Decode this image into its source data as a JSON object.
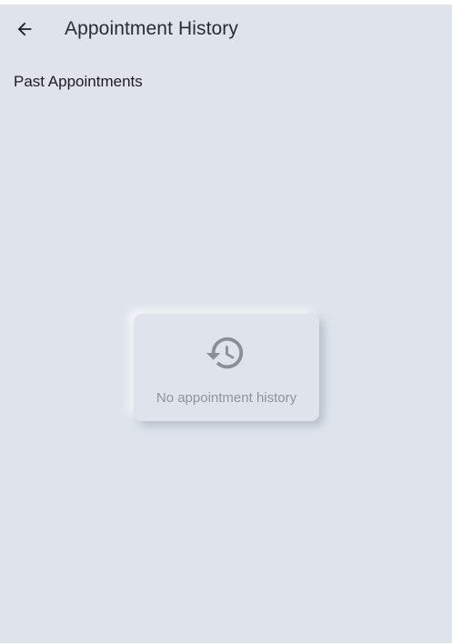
{
  "app_bar": {
    "title": "Appointment History",
    "back_icon": "arrow-back-icon"
  },
  "section": {
    "title": "Past Appointments"
  },
  "empty_state": {
    "icon": "history-icon",
    "message": "No appointment history"
  },
  "colors": {
    "background": "#dfe4ec",
    "title_text": "#2a2c30",
    "muted_text": "#8f949c",
    "icon": "#8a8f97"
  }
}
